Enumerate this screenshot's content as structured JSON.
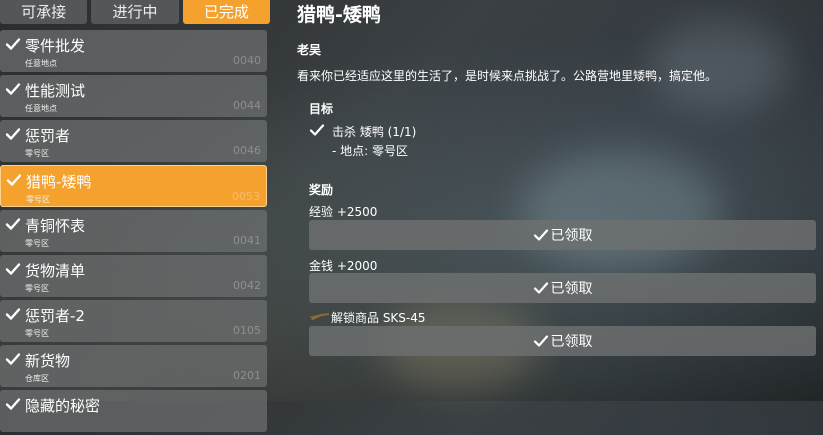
{
  "tabs": [
    {
      "label": "可承接",
      "active": false
    },
    {
      "label": "进行中",
      "active": false
    },
    {
      "label": "已完成",
      "active": true
    }
  ],
  "quests": [
    {
      "title": "零件批发",
      "location": "任意地点",
      "code": "0040",
      "selected": false
    },
    {
      "title": "性能测试",
      "location": "任意地点",
      "code": "0044",
      "selected": false
    },
    {
      "title": "惩罚者",
      "location": "零号区",
      "code": "0046",
      "selected": false
    },
    {
      "title": "猎鸭-矮鸭",
      "location": "零号区",
      "code": "0053",
      "selected": true
    },
    {
      "title": "青铜怀表",
      "location": "零号区",
      "code": "0041",
      "selected": false
    },
    {
      "title": "货物清单",
      "location": "零号区",
      "code": "0042",
      "selected": false
    },
    {
      "title": "惩罚者-2",
      "location": "零号区",
      "code": "0105",
      "selected": false
    },
    {
      "title": "新货物",
      "location": "仓库区",
      "code": "0201",
      "selected": false
    },
    {
      "title": "隐藏的秘密",
      "location": "",
      "code": "",
      "selected": false
    }
  ],
  "detail": {
    "title": "猎鸭-矮鸭",
    "giver": "老吴",
    "description": "看来你已经适应这里的生活了，是时候来点挑战了。公路营地里矮鸭，搞定他。",
    "goal_heading": "目标",
    "goal_text": "击杀 矮鸭 (1/1)",
    "goal_location": "- 地点: 零号区",
    "reward_heading": "奖励",
    "rewards": [
      {
        "label": "经验 +2500",
        "button": "已领取"
      },
      {
        "label": "金钱 +2000",
        "button": "已领取"
      },
      {
        "label": "解锁商品 SKS-45",
        "button": "已领取",
        "icon": "rifle-icon"
      }
    ]
  },
  "colors": {
    "accent": "#f5a12e",
    "panel": "#6e7070"
  }
}
